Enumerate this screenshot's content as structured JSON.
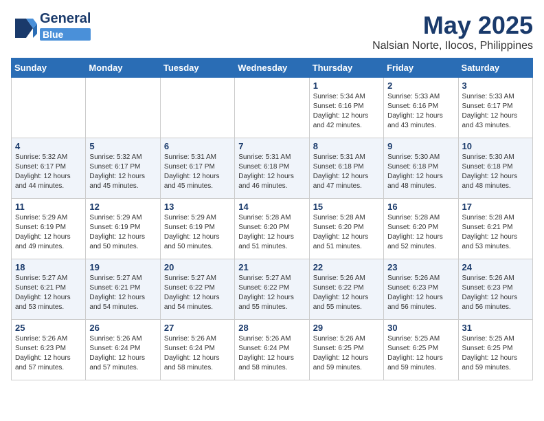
{
  "header": {
    "logo_general": "General",
    "logo_blue": "Blue",
    "month": "May 2025",
    "location": "Nalsian Norte, Ilocos, Philippines"
  },
  "days_of_week": [
    "Sunday",
    "Monday",
    "Tuesday",
    "Wednesday",
    "Thursday",
    "Friday",
    "Saturday"
  ],
  "weeks": [
    [
      {
        "day": "",
        "info": ""
      },
      {
        "day": "",
        "info": ""
      },
      {
        "day": "",
        "info": ""
      },
      {
        "day": "",
        "info": ""
      },
      {
        "day": "1",
        "info": "Sunrise: 5:34 AM\nSunset: 6:16 PM\nDaylight: 12 hours\nand 42 minutes."
      },
      {
        "day": "2",
        "info": "Sunrise: 5:33 AM\nSunset: 6:16 PM\nDaylight: 12 hours\nand 43 minutes."
      },
      {
        "day": "3",
        "info": "Sunrise: 5:33 AM\nSunset: 6:17 PM\nDaylight: 12 hours\nand 43 minutes."
      }
    ],
    [
      {
        "day": "4",
        "info": "Sunrise: 5:32 AM\nSunset: 6:17 PM\nDaylight: 12 hours\nand 44 minutes."
      },
      {
        "day": "5",
        "info": "Sunrise: 5:32 AM\nSunset: 6:17 PM\nDaylight: 12 hours\nand 45 minutes."
      },
      {
        "day": "6",
        "info": "Sunrise: 5:31 AM\nSunset: 6:17 PM\nDaylight: 12 hours\nand 45 minutes."
      },
      {
        "day": "7",
        "info": "Sunrise: 5:31 AM\nSunset: 6:18 PM\nDaylight: 12 hours\nand 46 minutes."
      },
      {
        "day": "8",
        "info": "Sunrise: 5:31 AM\nSunset: 6:18 PM\nDaylight: 12 hours\nand 47 minutes."
      },
      {
        "day": "9",
        "info": "Sunrise: 5:30 AM\nSunset: 6:18 PM\nDaylight: 12 hours\nand 48 minutes."
      },
      {
        "day": "10",
        "info": "Sunrise: 5:30 AM\nSunset: 6:18 PM\nDaylight: 12 hours\nand 48 minutes."
      }
    ],
    [
      {
        "day": "11",
        "info": "Sunrise: 5:29 AM\nSunset: 6:19 PM\nDaylight: 12 hours\nand 49 minutes."
      },
      {
        "day": "12",
        "info": "Sunrise: 5:29 AM\nSunset: 6:19 PM\nDaylight: 12 hours\nand 50 minutes."
      },
      {
        "day": "13",
        "info": "Sunrise: 5:29 AM\nSunset: 6:19 PM\nDaylight: 12 hours\nand 50 minutes."
      },
      {
        "day": "14",
        "info": "Sunrise: 5:28 AM\nSunset: 6:20 PM\nDaylight: 12 hours\nand 51 minutes."
      },
      {
        "day": "15",
        "info": "Sunrise: 5:28 AM\nSunset: 6:20 PM\nDaylight: 12 hours\nand 51 minutes."
      },
      {
        "day": "16",
        "info": "Sunrise: 5:28 AM\nSunset: 6:20 PM\nDaylight: 12 hours\nand 52 minutes."
      },
      {
        "day": "17",
        "info": "Sunrise: 5:28 AM\nSunset: 6:21 PM\nDaylight: 12 hours\nand 53 minutes."
      }
    ],
    [
      {
        "day": "18",
        "info": "Sunrise: 5:27 AM\nSunset: 6:21 PM\nDaylight: 12 hours\nand 53 minutes."
      },
      {
        "day": "19",
        "info": "Sunrise: 5:27 AM\nSunset: 6:21 PM\nDaylight: 12 hours\nand 54 minutes."
      },
      {
        "day": "20",
        "info": "Sunrise: 5:27 AM\nSunset: 6:22 PM\nDaylight: 12 hours\nand 54 minutes."
      },
      {
        "day": "21",
        "info": "Sunrise: 5:27 AM\nSunset: 6:22 PM\nDaylight: 12 hours\nand 55 minutes."
      },
      {
        "day": "22",
        "info": "Sunrise: 5:26 AM\nSunset: 6:22 PM\nDaylight: 12 hours\nand 55 minutes."
      },
      {
        "day": "23",
        "info": "Sunrise: 5:26 AM\nSunset: 6:23 PM\nDaylight: 12 hours\nand 56 minutes."
      },
      {
        "day": "24",
        "info": "Sunrise: 5:26 AM\nSunset: 6:23 PM\nDaylight: 12 hours\nand 56 minutes."
      }
    ],
    [
      {
        "day": "25",
        "info": "Sunrise: 5:26 AM\nSunset: 6:23 PM\nDaylight: 12 hours\nand 57 minutes."
      },
      {
        "day": "26",
        "info": "Sunrise: 5:26 AM\nSunset: 6:24 PM\nDaylight: 12 hours\nand 57 minutes."
      },
      {
        "day": "27",
        "info": "Sunrise: 5:26 AM\nSunset: 6:24 PM\nDaylight: 12 hours\nand 58 minutes."
      },
      {
        "day": "28",
        "info": "Sunrise: 5:26 AM\nSunset: 6:24 PM\nDaylight: 12 hours\nand 58 minutes."
      },
      {
        "day": "29",
        "info": "Sunrise: 5:26 AM\nSunset: 6:25 PM\nDaylight: 12 hours\nand 59 minutes."
      },
      {
        "day": "30",
        "info": "Sunrise: 5:25 AM\nSunset: 6:25 PM\nDaylight: 12 hours\nand 59 minutes."
      },
      {
        "day": "31",
        "info": "Sunrise: 5:25 AM\nSunset: 6:25 PM\nDaylight: 12 hours\nand 59 minutes."
      }
    ]
  ]
}
